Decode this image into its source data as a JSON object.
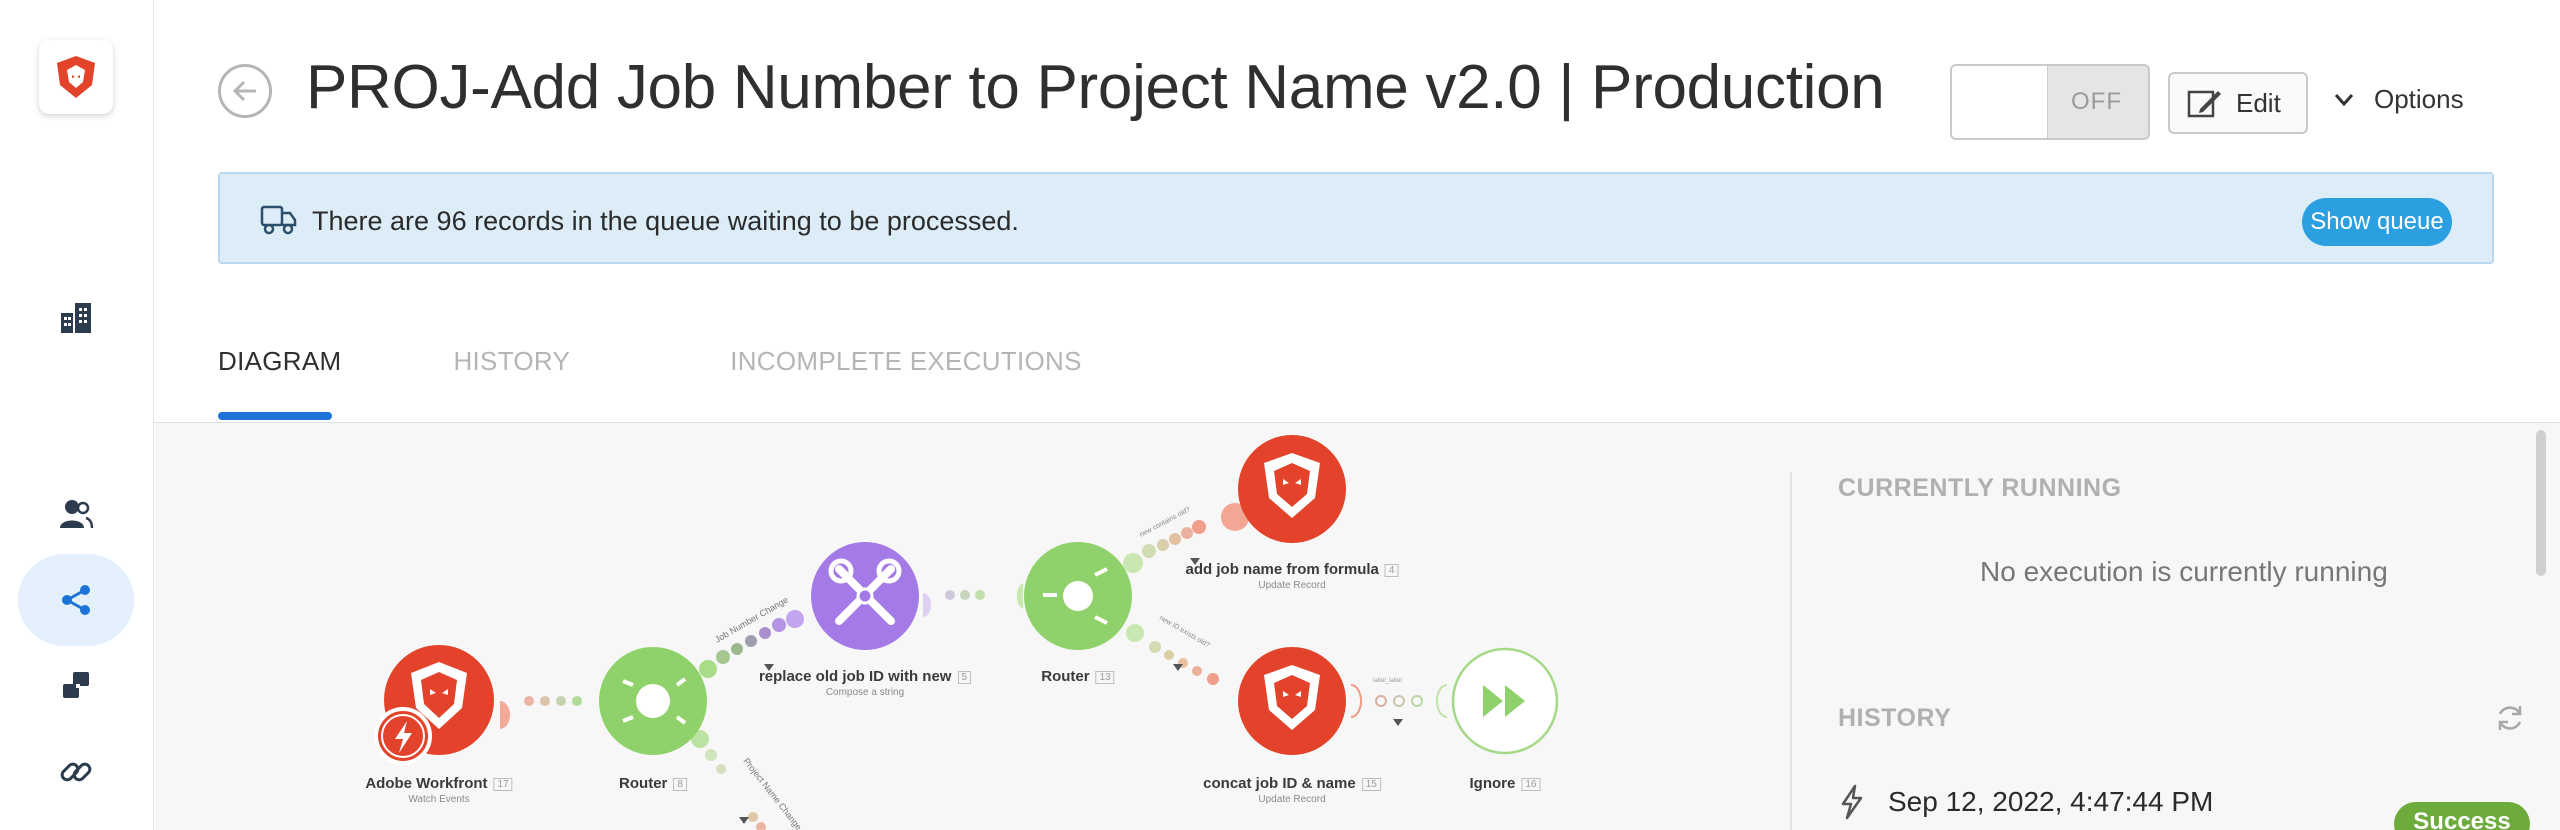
{
  "header": {
    "title": "PROJ-Add Job Number to Project Name v2.0 | Production",
    "toggle_label": "OFF",
    "edit_label": "Edit",
    "options_label": "Options"
  },
  "banner": {
    "text": "There are 96 records in the queue waiting to be processed.",
    "button_label": "Show queue"
  },
  "tabs": [
    {
      "label": "DIAGRAM",
      "active": true
    },
    {
      "label": "HISTORY",
      "active": false
    },
    {
      "label": "INCOMPLETE EXECUTIONS",
      "active": false
    }
  ],
  "diagram": {
    "nodes": [
      {
        "label": "Adobe Workfront",
        "num": "17",
        "sub": "Watch Events"
      },
      {
        "label": "Router",
        "num": "8",
        "sub": ""
      },
      {
        "label": "replace old job ID with new",
        "num": "5",
        "sub": "Compose a string"
      },
      {
        "label": "Router",
        "num": "13",
        "sub": ""
      },
      {
        "label": "add job name from formula",
        "num": "4",
        "sub": "Update Record"
      },
      {
        "label": "concat job ID & name",
        "num": "15",
        "sub": "Update Record"
      },
      {
        "label": "Ignore",
        "num": "16",
        "sub": ""
      }
    ],
    "route_labels": [
      "Job Number Change",
      "Project Name Change",
      "new contains old?",
      "new ID exists old?"
    ]
  },
  "panel": {
    "running_title": "CURRENTLY RUNNING",
    "running_empty": "No execution is currently running",
    "history_title": "HISTORY",
    "history_items": [
      {
        "time": "Sep 12, 2022, 4:47:44 PM",
        "status": "Success"
      }
    ]
  },
  "colors": {
    "accent": "#1d73d6",
    "workfront_red": "#e2432a",
    "router_green": "#8fd16a",
    "tools_purple": "#a47be6",
    "success_green": "#6cab3c",
    "banner_bg": "#dcedf8"
  }
}
